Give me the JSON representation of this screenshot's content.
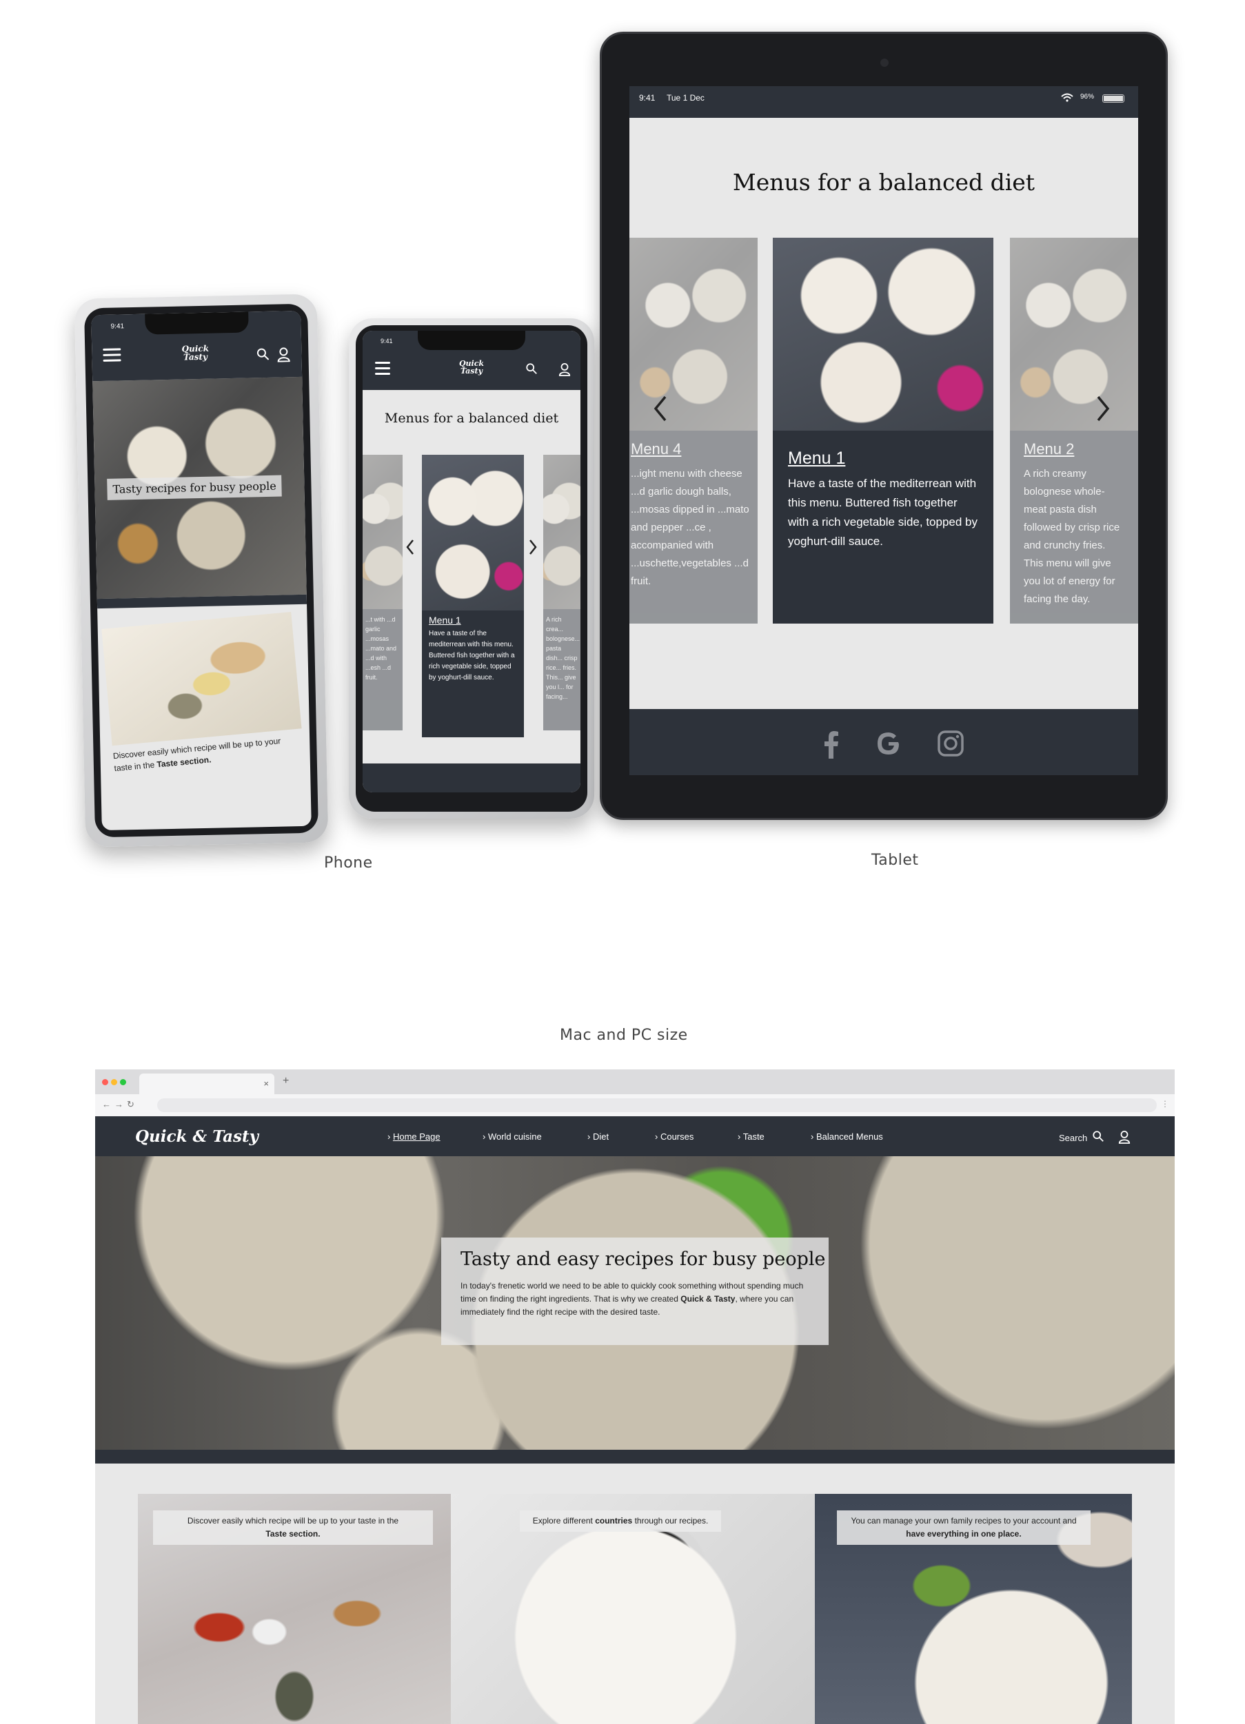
{
  "captions": {
    "phone": "Phone",
    "tablet": "Tablet",
    "desktop": "Mac and PC size"
  },
  "status": {
    "phone_time": "9:41",
    "tablet_time": "9:41",
    "tablet_date": "Tue 1 Dec",
    "tablet_battery": "96%"
  },
  "brand": {
    "logo_line1": "Quick",
    "logo_amp": "&",
    "logo_line2": "Tasty",
    "desktop_logo": "Quick & Tasty"
  },
  "phone1": {
    "hero_title": "Tasty recipes for busy people",
    "taste_text_1": "Discover easily which recipe will be up to your",
    "taste_text_2": "taste in the",
    "taste_text_bold": "Taste section."
  },
  "phone2": {
    "title": "Menus for a balanced diet",
    "menu_name": "Menu 1",
    "menu_desc": "Have a taste of the mediterrean with this menu. Buttered fish together with a rich vegetable side, topped by yoghurt-dill sauce.",
    "left_snippet": "...t with ...d garlic ...mosas ...mato and ...d with ...esh ...d fruit.",
    "right_snippet": "A rich crea... bolognese... pasta dish... crisp rice... fries. This... give you l... for facing..."
  },
  "tablet": {
    "title": "Menus for a balanced diet",
    "left_menu_name": "Menu 4",
    "left_menu_desc": "...ight menu with cheese ...d garlic dough balls, ...mosas dipped in ...mato and pepper ...ce , accompanied with ...uschette,vegetables ...d fruit.",
    "center_menu_name": "Menu 1",
    "center_menu_desc": "Have a taste of the mediterrean with this menu. Buttered fish together with a rich vegetable side, topped by yoghurt-dill sauce.",
    "right_menu_name": "Menu 2",
    "right_menu_desc": "A rich creamy bolognese whole-meat pasta dish followed by crisp rice and crunchy fries. This menu will give you lot of energy for facing the day."
  },
  "desktop": {
    "tab_close": "×",
    "tab_new": "+",
    "nav_items": [
      "Home Page",
      "World cuisine",
      "Diet",
      "Courses",
      "Taste",
      "Balanced Menus"
    ],
    "search_label": "Search",
    "hero_title": "Tasty and easy recipes for busy people",
    "hero_text_1": "In today's frenetic world we need to be able to quickly cook something without spending much time on finding the right ingredients. That is why we created",
    "hero_text_bold": "Quick & Tasty",
    "hero_text_2": ", where you can immediately find the right recipe with the desired taste.",
    "card1_text": "Discover easily which recipe will be up to your taste in the",
    "card1_bold": "Taste section.",
    "card2_text_a": "Explore different",
    "card2_bold": "countries",
    "card2_text_b": "through our recipes.",
    "card3_text": "You can manage your own family recipes to your account and",
    "card3_bold": "have  everything in one place."
  },
  "colors": {
    "dark_nav": "#2d323a",
    "page_bg": "#e8e8e8",
    "accent_traffic": [
      "#ff5f57",
      "#febc2e",
      "#28c840"
    ]
  },
  "icons": [
    "hamburger-icon",
    "search-icon",
    "user-icon",
    "chevron-left-icon",
    "chevron-right-icon",
    "facebook-icon",
    "google-icon",
    "instagram-icon",
    "wifi-icon",
    "battery-icon",
    "back-icon",
    "forward-icon",
    "reload-icon"
  ]
}
